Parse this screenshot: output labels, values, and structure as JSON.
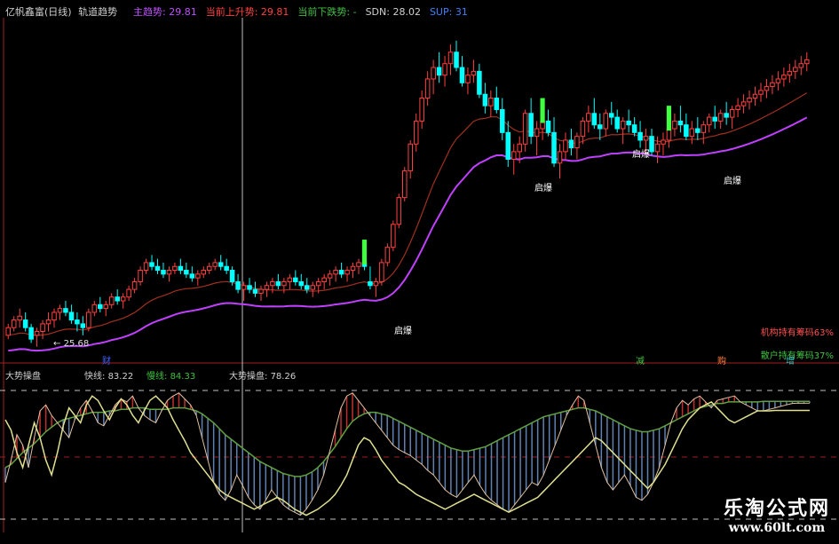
{
  "header": {
    "title": "亿帆鑫富(日线)",
    "indicator_name": "轨道趋势",
    "items": [
      {
        "label": "主趋势:",
        "value": "29.81",
        "color": "#c050ff"
      },
      {
        "label": "当前上升势:",
        "value": "29.81",
        "color": "#ff4040"
      },
      {
        "label": "当前下跌势:",
        "value": "-",
        "color": "#40c040"
      },
      {
        "label": "SDN:",
        "value": "28.02",
        "color": "#d0d0d0"
      },
      {
        "label": "SUP:",
        "value": "31",
        "color": "#4080ff"
      }
    ]
  },
  "main_panel": {
    "low_marker": "25.68",
    "signals": [
      "启爆",
      "启爆",
      "启爆",
      "启爆"
    ],
    "holdings": [
      {
        "text": "机构持有筹码63%",
        "color": "#ff5050"
      },
      {
        "text": "散户持有筹码37%",
        "color": "#40c040"
      }
    ],
    "bottom_tags": [
      {
        "text": "财",
        "color": "#4060ff"
      },
      {
        "text": "减",
        "color": "#40c040"
      },
      {
        "text": "购",
        "color": "#ff8040"
      },
      {
        "text": "增",
        "color": "#40c0c0"
      }
    ]
  },
  "sub_panel": {
    "title": "大势操盘",
    "fast_label": "快线:",
    "fast_value": "83.22",
    "slow_label": "慢线:",
    "slow_value": "84.33",
    "trend_label": "大势操盘:",
    "trend_value": "78.26"
  },
  "watermark": {
    "cn": "乐淘公式网",
    "url": "www.60lt.com"
  },
  "colors": {
    "up": "#ff4040",
    "down": "#00ffff",
    "signal": "#40ff40",
    "main_trend": "#c040ff",
    "up_line": "#a03020",
    "slow_line": "#60a040",
    "trend_line": "#e0e090"
  },
  "chart_data": {
    "type": "line",
    "x": [
      0,
      1,
      2,
      3,
      4,
      5,
      6,
      7,
      8,
      9,
      10,
      11,
      12,
      13,
      14,
      15,
      16,
      17,
      18,
      19,
      20,
      21,
      22,
      23,
      24,
      25,
      26,
      27,
      28,
      29,
      30,
      31,
      32,
      33,
      34,
      35,
      36,
      37,
      38,
      39,
      40,
      41,
      42,
      43,
      44,
      45,
      46,
      47,
      48,
      49,
      50,
      51,
      52,
      53,
      54,
      55,
      56,
      57,
      58,
      59,
      60,
      61,
      62,
      63,
      64,
      65,
      66,
      67,
      68,
      69,
      70,
      71,
      72,
      73,
      74,
      75,
      76,
      77,
      78,
      79,
      80,
      81,
      82,
      83,
      84,
      85,
      86,
      87,
      88,
      89,
      90,
      91,
      92,
      93,
      94,
      95,
      96,
      97,
      98,
      99,
      100,
      101,
      102,
      103,
      104,
      105,
      106,
      107,
      108,
      109,
      110,
      111,
      112,
      113,
      114,
      115,
      116,
      117,
      118,
      119,
      120,
      121,
      122,
      123,
      124,
      125,
      126,
      127,
      128,
      129,
      130,
      131,
      132,
      133,
      134,
      135,
      136,
      137,
      138,
      139
    ],
    "candles_ohlc": [
      [
        24.2,
        24.5,
        24.1,
        24.4
      ],
      [
        24.4,
        24.7,
        24.3,
        24.6
      ],
      [
        24.6,
        24.9,
        24.4,
        24.7
      ],
      [
        24.6,
        24.8,
        24.3,
        24.4
      ],
      [
        24.4,
        24.5,
        24.0,
        24.1
      ],
      [
        24.2,
        24.4,
        23.9,
        24.3
      ],
      [
        24.3,
        24.6,
        24.1,
        24.5
      ],
      [
        24.5,
        24.8,
        24.3,
        24.6
      ],
      [
        24.6,
        24.9,
        24.4,
        24.8
      ],
      [
        24.8,
        25.0,
        24.6,
        24.9
      ],
      [
        24.9,
        25.1,
        24.7,
        24.8
      ],
      [
        24.8,
        25.0,
        24.5,
        24.6
      ],
      [
        24.6,
        24.8,
        24.3,
        24.5
      ],
      [
        24.5,
        24.7,
        24.2,
        24.4
      ],
      [
        24.4,
        24.9,
        24.3,
        24.8
      ],
      [
        24.8,
        25.1,
        24.7,
        25.0
      ],
      [
        25.0,
        25.2,
        24.8,
        24.9
      ],
      [
        24.9,
        25.1,
        24.7,
        25.0
      ],
      [
        25.0,
        25.3,
        24.9,
        25.2
      ],
      [
        25.2,
        25.4,
        25.0,
        25.1
      ],
      [
        25.1,
        25.3,
        24.9,
        25.2
      ],
      [
        25.2,
        25.5,
        25.1,
        25.4
      ],
      [
        25.4,
        25.7,
        25.3,
        25.6
      ],
      [
        25.6,
        26.0,
        25.5,
        25.9
      ],
      [
        25.9,
        26.2,
        25.8,
        26.1
      ],
      [
        26.1,
        26.3,
        25.9,
        26.0
      ],
      [
        26.0,
        26.2,
        25.8,
        25.9
      ],
      [
        25.9,
        26.1,
        25.7,
        25.8
      ],
      [
        25.8,
        26.0,
        25.6,
        25.9
      ],
      [
        25.9,
        26.1,
        25.8,
        26.0
      ],
      [
        26.0,
        26.2,
        25.8,
        25.9
      ],
      [
        25.9,
        26.1,
        25.7,
        25.8
      ],
      [
        25.8,
        26.0,
        25.6,
        25.7
      ],
      [
        25.7,
        25.9,
        25.5,
        25.8
      ],
      [
        25.8,
        26.0,
        25.7,
        25.9
      ],
      [
        25.9,
        26.1,
        25.8,
        26.0
      ],
      [
        26.0,
        26.2,
        25.9,
        26.1
      ],
      [
        26.1,
        26.3,
        25.9,
        26.0
      ],
      [
        26.0,
        26.2,
        25.8,
        25.9
      ],
      [
        25.9,
        26.0,
        25.5,
        25.6
      ],
      [
        25.6,
        25.8,
        25.3,
        25.4
      ],
      [
        25.4,
        25.6,
        25.1,
        25.5
      ],
      [
        25.5,
        25.7,
        25.3,
        25.4
      ],
      [
        25.4,
        25.6,
        25.2,
        25.3
      ],
      [
        25.3,
        25.5,
        25.1,
        25.4
      ],
      [
        25.4,
        25.6,
        25.2,
        25.5
      ],
      [
        25.5,
        25.7,
        25.3,
        25.6
      ],
      [
        25.6,
        25.8,
        25.4,
        25.5
      ],
      [
        25.5,
        25.7,
        25.3,
        25.6
      ],
      [
        25.6,
        25.8,
        25.4,
        25.7
      ],
      [
        25.7,
        25.9,
        25.5,
        25.6
      ],
      [
        25.6,
        25.8,
        25.4,
        25.5
      ],
      [
        25.5,
        25.7,
        25.3,
        25.4
      ],
      [
        25.4,
        25.6,
        25.2,
        25.5
      ],
      [
        25.5,
        25.7,
        25.3,
        25.6
      ],
      [
        25.6,
        25.8,
        25.4,
        25.7
      ],
      [
        25.7,
        25.9,
        25.5,
        25.8
      ],
      [
        25.8,
        26.0,
        25.6,
        25.9
      ],
      [
        25.9,
        26.1,
        25.7,
        25.8
      ],
      [
        25.8,
        26.0,
        25.6,
        25.9
      ],
      [
        25.9,
        26.1,
        25.7,
        26.0
      ],
      [
        26.0,
        26.2,
        25.8,
        26.1
      ],
      [
        26.1,
        26.3,
        25.9,
        26.0
      ],
      [
        25.6,
        26.0,
        25.4,
        25.5
      ],
      [
        25.5,
        25.7,
        25.2,
        25.6
      ],
      [
        25.6,
        26.2,
        25.5,
        26.1
      ],
      [
        26.1,
        26.6,
        26.0,
        26.5
      ],
      [
        26.5,
        27.2,
        26.4,
        27.1
      ],
      [
        27.1,
        27.9,
        27.0,
        27.8
      ],
      [
        27.8,
        28.6,
        27.7,
        28.5
      ],
      [
        28.5,
        29.3,
        28.3,
        29.2
      ],
      [
        29.2,
        30.0,
        29.0,
        29.8
      ],
      [
        29.8,
        30.6,
        29.6,
        30.4
      ],
      [
        30.4,
        31.1,
        30.2,
        30.9
      ],
      [
        30.9,
        31.4,
        30.5,
        31.2
      ],
      [
        31.2,
        31.6,
        30.8,
        31.0
      ],
      [
        31.0,
        31.5,
        30.7,
        31.3
      ],
      [
        31.3,
        31.8,
        31.0,
        31.6
      ],
      [
        31.6,
        31.9,
        31.1,
        31.2
      ],
      [
        31.2,
        31.5,
        30.7,
        30.8
      ],
      [
        30.8,
        31.2,
        30.5,
        31.0
      ],
      [
        31.0,
        31.4,
        30.8,
        31.1
      ],
      [
        31.1,
        31.3,
        30.4,
        30.5
      ],
      [
        30.5,
        30.8,
        30.0,
        30.2
      ],
      [
        30.2,
        30.6,
        29.9,
        30.4
      ],
      [
        30.4,
        30.7,
        30.0,
        30.1
      ],
      [
        30.1,
        30.4,
        29.3,
        29.5
      ],
      [
        29.5,
        29.8,
        28.6,
        28.8
      ],
      [
        28.8,
        29.2,
        28.4,
        29.0
      ],
      [
        29.0,
        29.4,
        28.7,
        29.2
      ],
      [
        29.2,
        30.1,
        29.0,
        30.0
      ],
      [
        30.0,
        30.4,
        29.2,
        29.4
      ],
      [
        29.4,
        29.8,
        28.9,
        29.6
      ],
      [
        29.6,
        30.0,
        29.3,
        29.8
      ],
      [
        29.8,
        30.1,
        29.4,
        29.5
      ],
      [
        29.5,
        29.9,
        28.6,
        28.7
      ],
      [
        28.7,
        29.2,
        28.3,
        29.0
      ],
      [
        29.0,
        29.5,
        28.8,
        29.3
      ],
      [
        29.3,
        29.6,
        28.9,
        29.1
      ],
      [
        29.1,
        29.5,
        28.8,
        29.4
      ],
      [
        29.4,
        29.9,
        29.2,
        29.8
      ],
      [
        29.8,
        30.2,
        29.5,
        30.0
      ],
      [
        30.0,
        30.4,
        29.6,
        29.7
      ],
      [
        29.7,
        30.0,
        29.3,
        29.6
      ],
      [
        29.6,
        30.1,
        29.4,
        30.0
      ],
      [
        30.0,
        30.3,
        29.7,
        29.9
      ],
      [
        29.9,
        30.1,
        29.5,
        29.6
      ],
      [
        29.6,
        29.9,
        29.2,
        29.8
      ],
      [
        29.8,
        30.1,
        29.5,
        29.7
      ],
      [
        29.7,
        29.9,
        29.4,
        29.5
      ],
      [
        29.5,
        29.8,
        29.1,
        29.3
      ],
      [
        29.3,
        29.6,
        29.0,
        29.4
      ],
      [
        29.4,
        29.6,
        28.9,
        29.0
      ],
      [
        29.0,
        29.4,
        28.7,
        29.2
      ],
      [
        29.2,
        29.5,
        28.9,
        29.3
      ],
      [
        29.3,
        29.7,
        29.1,
        29.6
      ],
      [
        29.6,
        30.0,
        29.4,
        29.8
      ],
      [
        29.8,
        30.2,
        29.5,
        29.7
      ],
      [
        29.7,
        30.0,
        29.3,
        29.4
      ],
      [
        29.4,
        29.8,
        29.2,
        29.6
      ],
      [
        29.6,
        29.9,
        29.3,
        29.5
      ],
      [
        29.5,
        29.8,
        29.2,
        29.7
      ],
      [
        29.7,
        30.0,
        29.5,
        29.9
      ],
      [
        29.9,
        30.2,
        29.6,
        29.8
      ],
      [
        29.8,
        30.1,
        29.6,
        30.0
      ],
      [
        30.0,
        30.3,
        29.7,
        29.9
      ],
      [
        29.9,
        30.2,
        29.6,
        30.1
      ],
      [
        30.1,
        30.4,
        29.9,
        30.2
      ],
      [
        30.2,
        30.5,
        30.0,
        30.3
      ],
      [
        30.3,
        30.6,
        30.1,
        30.4
      ],
      [
        30.4,
        30.7,
        30.2,
        30.5
      ],
      [
        30.5,
        30.8,
        30.3,
        30.6
      ],
      [
        30.6,
        30.9,
        30.4,
        30.7
      ],
      [
        30.7,
        31.0,
        30.5,
        30.8
      ],
      [
        30.8,
        31.1,
        30.6,
        30.9
      ],
      [
        30.9,
        31.2,
        30.7,
        31.0
      ],
      [
        31.0,
        31.3,
        30.8,
        31.1
      ],
      [
        31.1,
        31.4,
        30.9,
        31.2
      ],
      [
        31.2,
        31.5,
        31.0,
        31.3
      ],
      [
        31.3,
        31.6,
        31.1,
        31.4
      ]
    ],
    "sub_fast": [
      30,
      45,
      62,
      55,
      40,
      60,
      78,
      82,
      75,
      70,
      65,
      60,
      72,
      80,
      85,
      78,
      70,
      68,
      75,
      82,
      86,
      84,
      88,
      80,
      75,
      72,
      70,
      78,
      85,
      88,
      90,
      86,
      82,
      75,
      60,
      45,
      30,
      22,
      18,
      25,
      35,
      28,
      20,
      15,
      12,
      18,
      25,
      20,
      15,
      12,
      10,
      8,
      12,
      18,
      25,
      35,
      50,
      65,
      80,
      88,
      90,
      85,
      80,
      75,
      70,
      65,
      60,
      55,
      52,
      50,
      48,
      45,
      42,
      38,
      35,
      30,
      25,
      22,
      20,
      25,
      30,
      35,
      28,
      22,
      18,
      15,
      12,
      10,
      15,
      20,
      25,
      30,
      28,
      35,
      45,
      55,
      65,
      75,
      82,
      88,
      85,
      70,
      55,
      40,
      30,
      25,
      30,
      35,
      28,
      20,
      18,
      22,
      30,
      40,
      55,
      70,
      80,
      85,
      82,
      86,
      88,
      84,
      80,
      85,
      86,
      87,
      88,
      84,
      82,
      80,
      78,
      78,
      79,
      80,
      81,
      82,
      83,
      83.22,
      83.1,
      83.22
    ],
    "sub_slow": [
      40,
      42,
      46,
      50,
      53,
      56,
      60,
      64,
      67,
      70,
      72,
      73,
      74,
      75,
      76,
      77,
      77,
      77,
      78,
      78,
      79,
      79,
      80,
      80,
      80,
      79,
      79,
      79,
      79,
      80,
      80,
      80,
      79,
      78,
      76,
      73,
      70,
      66,
      62,
      59,
      56,
      53,
      50,
      47,
      44,
      42,
      40,
      38,
      36,
      35,
      34,
      34,
      35,
      37,
      40,
      44,
      49,
      54,
      60,
      66,
      71,
      74,
      76,
      77,
      77,
      76,
      75,
      73,
      71,
      69,
      67,
      65,
      63,
      61,
      59,
      57,
      55,
      53,
      52,
      51,
      51,
      52,
      53,
      54,
      56,
      58,
      60,
      62,
      64,
      66,
      68,
      70,
      72,
      74,
      75,
      76,
      77,
      78,
      79,
      80,
      80,
      79,
      78,
      76,
      74,
      72,
      70,
      68,
      66,
      65,
      64,
      64,
      65,
      66,
      68,
      70,
      72,
      74,
      76,
      78,
      80,
      81,
      82,
      83,
      83,
      84,
      84,
      84,
      84,
      84,
      84,
      84.33,
      84.33,
      84.33,
      84.33,
      84.33,
      84.33,
      84.33,
      84.33,
      84.33
    ],
    "sub_trend": [
      72,
      65,
      50,
      40,
      55,
      70,
      60,
      45,
      35,
      50,
      68,
      80,
      75,
      70,
      82,
      88,
      85,
      78,
      72,
      80,
      86,
      82,
      75,
      70,
      78,
      85,
      88,
      84,
      80,
      72,
      65,
      58,
      50,
      45,
      40,
      35,
      30,
      25,
      22,
      20,
      18,
      16,
      14,
      12,
      14,
      16,
      18,
      20,
      18,
      15,
      12,
      10,
      8,
      10,
      12,
      15,
      18,
      22,
      28,
      35,
      45,
      55,
      60,
      58,
      52,
      45,
      40,
      35,
      30,
      28,
      25,
      22,
      20,
      18,
      16,
      14,
      12,
      14,
      16,
      18,
      20,
      22,
      20,
      18,
      16,
      14,
      12,
      10,
      12,
      14,
      16,
      18,
      20,
      24,
      28,
      32,
      36,
      40,
      44,
      48,
      52,
      56,
      60,
      58,
      54,
      50,
      46,
      42,
      38,
      34,
      30,
      26,
      30,
      36,
      42,
      50,
      58,
      66,
      72,
      76,
      80,
      82,
      84,
      80,
      76,
      72,
      70,
      72,
      74,
      76,
      78,
      78,
      78,
      78.26,
      78.26,
      78.26,
      78.26,
      78.26,
      78.26,
      78.26
    ],
    "ylim_main": [
      23.5,
      32.5
    ],
    "ylim_sub": [
      0,
      100
    ],
    "grid": false
  }
}
